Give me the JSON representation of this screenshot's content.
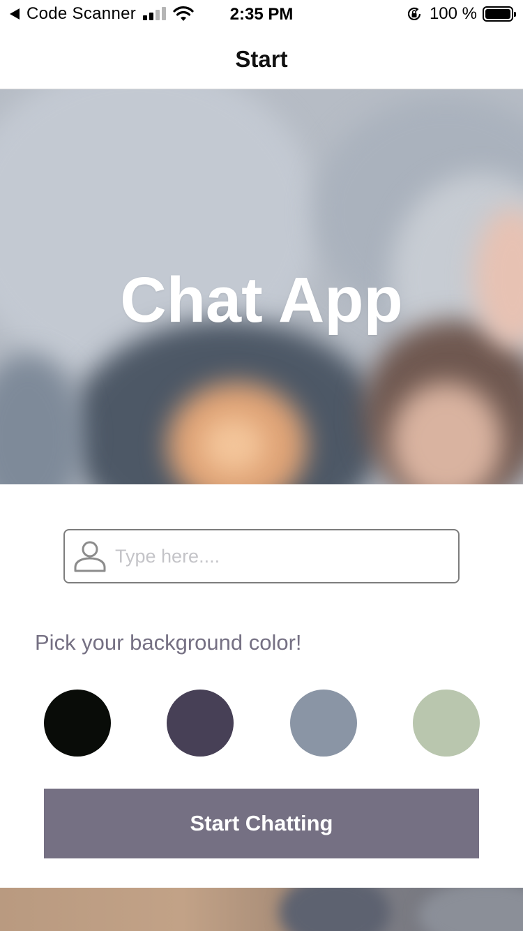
{
  "status_bar": {
    "back_app": "Code Scanner",
    "time": "2:35 PM",
    "battery_percent": "100 %",
    "battery_level": 1.0,
    "icons": [
      "back-arrow-icon",
      "signal-icon",
      "wifi-icon",
      "rotation-lock-icon",
      "battery-icon"
    ]
  },
  "nav": {
    "title": "Start"
  },
  "hero": {
    "title": "Chat App"
  },
  "form": {
    "name_input": {
      "value": "",
      "placeholder": "Type here....",
      "icon": "user-icon"
    },
    "color_prompt": "Pick your background color!",
    "colors": [
      "#090C08",
      "#474056",
      "#8A95A5",
      "#B9C6AE"
    ],
    "start_button": {
      "label": "Start Chatting",
      "color": "#757083"
    }
  }
}
